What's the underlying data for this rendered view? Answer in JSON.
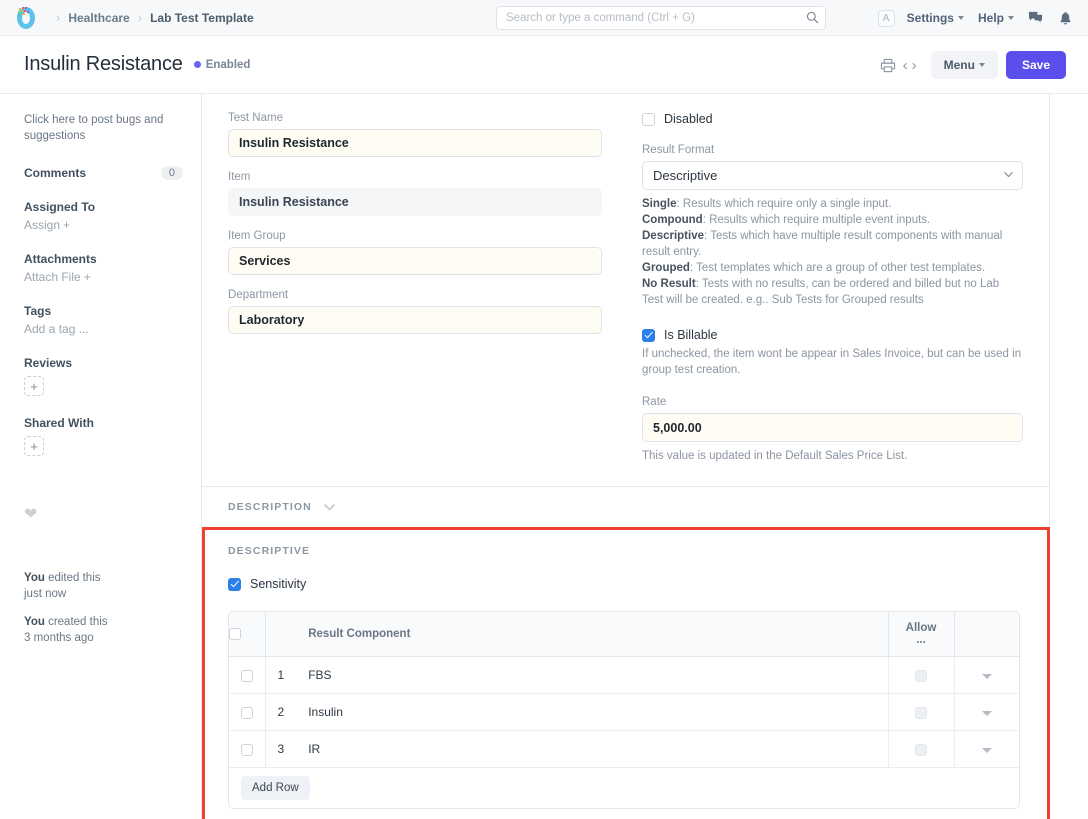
{
  "navbar": {
    "logo_name": "frappe-logo",
    "breadcrumb": [
      {
        "label": "Healthcare"
      },
      {
        "label": "Lab Test Template"
      }
    ],
    "search": {
      "placeholder": "Search or type a command (Ctrl + G)",
      "value": ""
    },
    "avatar_initial": "A",
    "links": [
      {
        "label": "Settings",
        "has_caret": true
      },
      {
        "label": "Help",
        "has_caret": true
      }
    ],
    "icons": [
      {
        "name": "chat-icon"
      },
      {
        "name": "bell-icon"
      }
    ]
  },
  "page_head": {
    "title": "Insulin Resistance",
    "status": "Enabled",
    "status_color": "#6e63f0",
    "print_icon": "printer-icon",
    "prev_label": "‹",
    "next_label": "›",
    "menu_label": "Menu",
    "save_label": "Save",
    "save_color": "#5a4fec"
  },
  "sidebar": {
    "note": "Click here to post bugs and suggestions",
    "comments_label": "Comments",
    "comments_count": "0",
    "assigned_to_label": "Assigned To",
    "assign_action": "Assign",
    "attachments_label": "Attachments",
    "attach_action": "Attach File",
    "tags_label": "Tags",
    "tags_action": "Add a tag ...",
    "reviews_label": "Reviews",
    "reviews_add": "+",
    "shared_with_label": "Shared With",
    "shared_add": "+",
    "like_icon": "heart-icon",
    "activity": [
      {
        "who": "You",
        "what": " edited this",
        "when": "just now"
      },
      {
        "who": "You",
        "what": " created this",
        "when": "3 months ago"
      }
    ]
  },
  "form": {
    "test_name": {
      "label": "Test Name",
      "value": "Insulin Resistance"
    },
    "item": {
      "label": "Item",
      "value": "Insulin Resistance"
    },
    "item_group": {
      "label": "Item Group",
      "value": "Services"
    },
    "department": {
      "label": "Department",
      "value": "Laboratory"
    },
    "disabled": {
      "label": "Disabled",
      "checked": false
    },
    "result_format": {
      "label": "Result Format",
      "value": "Descriptive",
      "options": [
        "Single",
        "Compound",
        "Descriptive",
        "Grouped",
        "No Result"
      ]
    },
    "result_format_help": [
      {
        "term": "Single",
        "text": ": Results which require only a single input."
      },
      {
        "term": "Compound",
        "text": ": Results which require multiple event inputs."
      },
      {
        "term": "Descriptive",
        "text": ": Tests which have multiple result components with manual result entry."
      },
      {
        "term": "Grouped",
        "text": ": Test templates which are a group of other test templates."
      },
      {
        "term": "No Result",
        "text": ": Tests with no results, can be ordered and billed but no Lab Test will be created. e.g.. Sub Tests for Grouped results"
      }
    ],
    "is_billable": {
      "label": "Is Billable",
      "checked": true
    },
    "is_billable_help": "If unchecked, the item wont be appear in Sales Invoice, but can be used in group test creation.",
    "rate": {
      "label": "Rate",
      "value": "5,000.00",
      "help": "This value is updated in the Default Sales Price List."
    }
  },
  "sections": {
    "description": {
      "title": "DESCRIPTION",
      "caret": "chevron-down-icon"
    },
    "descriptive": {
      "title": "DESCRIPTIVE"
    }
  },
  "sensitivity": {
    "label": "Sensitivity",
    "checked": true
  },
  "grid": {
    "columns": [
      "",
      "",
      "Result Component",
      "Allow ...",
      ""
    ],
    "header_result_component": "Result Component",
    "header_allow": "Allow ...",
    "rows": [
      {
        "index": "1",
        "result_component": "FBS"
      },
      {
        "index": "2",
        "result_component": "Insulin"
      },
      {
        "index": "3",
        "result_component": "IR"
      }
    ],
    "add_row_label": "Add Row"
  },
  "highlight": {
    "color": "#f0402f"
  }
}
